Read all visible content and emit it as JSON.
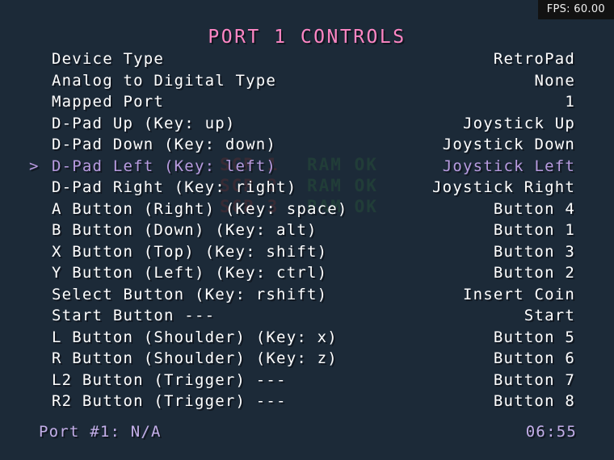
{
  "overlay": {
    "fps_label": "FPS: 60.00",
    "title": "PORT 1 CONTROLS",
    "cursor_glyph": ">",
    "selected_index": 5
  },
  "colors": {
    "background": "#1c2a38",
    "title": "#ff86c4",
    "text": "#ffffff",
    "highlight": "#b89be0",
    "status": "#c3aee8",
    "fps_background": "#121212",
    "ghost_red": "#7a2f2f",
    "ghost_green": "#2f6b3a"
  },
  "menu": {
    "rows": [
      {
        "label": "Device Type",
        "value": "RetroPad"
      },
      {
        "label": "Analog to Digital Type",
        "value": "None"
      },
      {
        "label": "Mapped Port",
        "value": "1"
      },
      {
        "label": "D-Pad Up (Key: up)",
        "value": "Joystick Up"
      },
      {
        "label": "D-Pad Down (Key: down)",
        "value": "Joystick Down"
      },
      {
        "label": "D-Pad Left (Key: left)",
        "value": "Joystick Left"
      },
      {
        "label": "D-Pad Right (Key: right)",
        "value": "Joystick Right"
      },
      {
        "label": "A Button (Right) (Key: space)",
        "value": "Button 4"
      },
      {
        "label": "B Button (Down) (Key: alt)",
        "value": "Button 1"
      },
      {
        "label": "X Button (Top) (Key: shift)",
        "value": "Button 3"
      },
      {
        "label": "Y Button (Left) (Key: ctrl)",
        "value": "Button 2"
      },
      {
        "label": "Select Button (Key: rshift)",
        "value": "Insert Coin"
      },
      {
        "label": "Start Button ---",
        "value": "Start"
      },
      {
        "label": "L Button (Shoulder) (Key: x)",
        "value": "Button 5"
      },
      {
        "label": "R Button (Shoulder) (Key: z)",
        "value": "Button 6"
      },
      {
        "label": "L2 Button (Trigger) ---",
        "value": "Button 7"
      },
      {
        "label": "R2 Button (Trigger) ---",
        "value": "Button 8"
      }
    ]
  },
  "status_bar": {
    "port_text": "Port #1: N/A",
    "time_text": "06:55"
  },
  "background_screen": {
    "lines": [
      {
        "scr": "SCR 1",
        "ram": "RAM OK"
      },
      {
        "scr": "SCR 2",
        "ram": "RAM OK"
      },
      {
        "scr": "SCR 3",
        "ram": "RAM OK"
      }
    ]
  }
}
